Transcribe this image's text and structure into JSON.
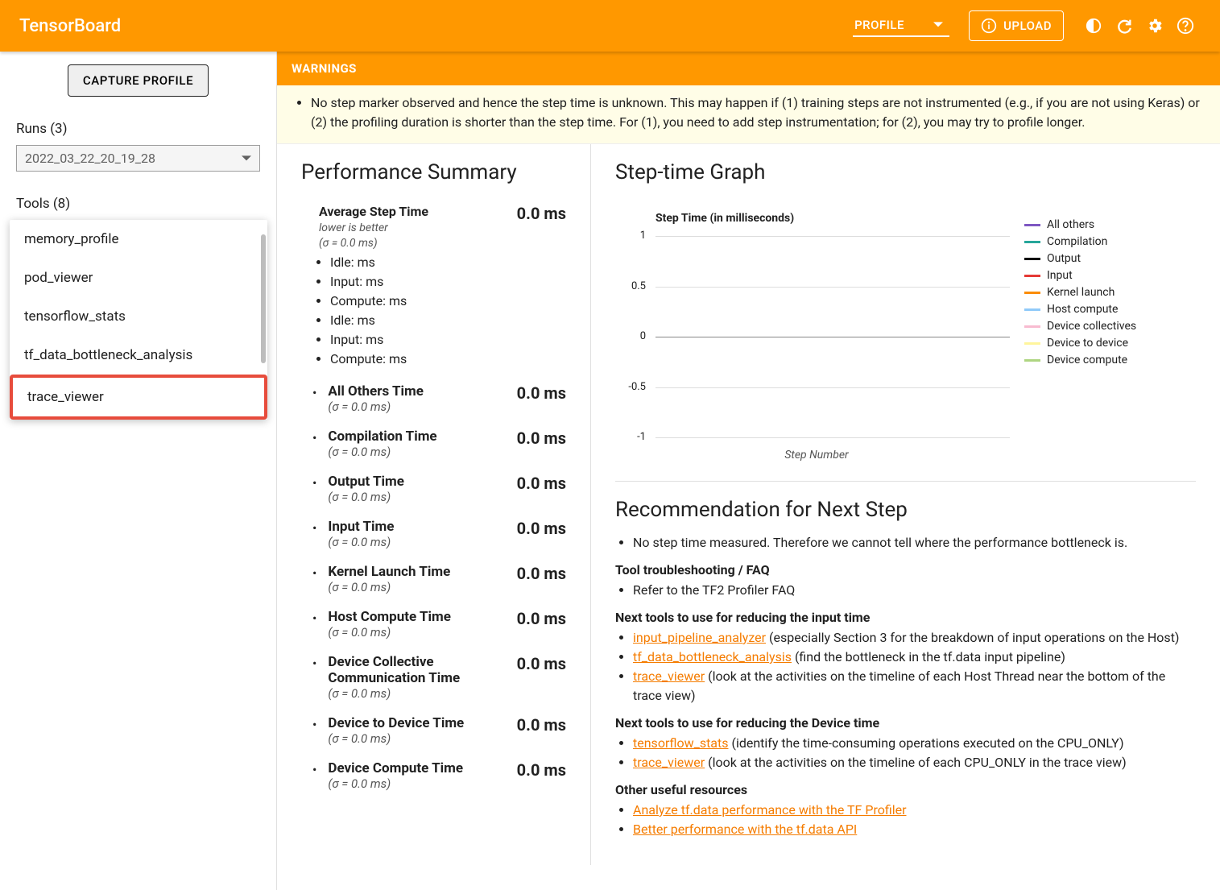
{
  "header": {
    "title": "TensorBoard",
    "mode": "PROFILE",
    "upload": "UPLOAD"
  },
  "sidebar": {
    "capture": "CAPTURE PROFILE",
    "runs_label": "Runs (3)",
    "run_selected": "2022_03_22_20_19_28",
    "tools_label": "Tools (8)",
    "tools": [
      "memory_profile",
      "pod_viewer",
      "tensorflow_stats",
      "tf_data_bottleneck_analysis",
      "trace_viewer"
    ]
  },
  "warnings": {
    "title": "WARNINGS",
    "items": [
      "No step marker observed and hence the step time is unknown. This may happen if (1) training steps are not instrumented (e.g., if you are not using Keras) or (2) the profiling duration is shorter than the step time. For (1), you need to add step instrumentation; for (2), you may try to profile longer."
    ]
  },
  "perf": {
    "title": "Performance Summary",
    "avg": {
      "label": "Average Step Time",
      "hint": "lower is better",
      "sigma": "(σ = 0.0 ms)",
      "val": "0.0 ms",
      "subs": [
        "Idle: ms",
        "Input: ms",
        "Compute: ms",
        "Idle: ms",
        "Input: ms",
        "Compute: ms"
      ]
    },
    "items": [
      {
        "label": "All Others Time",
        "sigma": "(σ = 0.0 ms)",
        "val": "0.0 ms"
      },
      {
        "label": "Compilation Time",
        "sigma": "(σ = 0.0 ms)",
        "val": "0.0 ms"
      },
      {
        "label": "Output Time",
        "sigma": "(σ = 0.0 ms)",
        "val": "0.0 ms"
      },
      {
        "label": "Input Time",
        "sigma": "(σ = 0.0 ms)",
        "val": "0.0 ms"
      },
      {
        "label": "Kernel Launch Time",
        "sigma": "(σ = 0.0 ms)",
        "val": "0.0 ms"
      },
      {
        "label": "Host Compute Time",
        "sigma": "(σ = 0.0 ms)",
        "val": "0.0 ms"
      },
      {
        "label": "Device Collective Communication Time",
        "sigma": "(σ = 0.0 ms)",
        "val": "0.0 ms"
      },
      {
        "label": "Device to Device Time",
        "sigma": "(σ = 0.0 ms)",
        "val": "0.0 ms"
      },
      {
        "label": "Device Compute Time",
        "sigma": "(σ = 0.0 ms)",
        "val": "0.0 ms"
      }
    ]
  },
  "chart_data": {
    "type": "line",
    "title": "Step Time (in milliseconds)",
    "xlabel": "Step Number",
    "ylabel": "",
    "ylim": [
      -1,
      1
    ],
    "yticks": [
      -1,
      -0.5,
      0,
      0.5,
      1
    ],
    "categories": [],
    "series": [
      {
        "name": "All others",
        "color": "#7e57c2",
        "values": []
      },
      {
        "name": "Compilation",
        "color": "#26a69a",
        "values": []
      },
      {
        "name": "Output",
        "color": "#000000",
        "values": []
      },
      {
        "name": "Input",
        "color": "#e53935",
        "values": []
      },
      {
        "name": "Kernel launch",
        "color": "#fb8c00",
        "values": []
      },
      {
        "name": "Host compute",
        "color": "#90caf9",
        "values": []
      },
      {
        "name": "Device collectives",
        "color": "#f8bbd0",
        "values": []
      },
      {
        "name": "Device to device",
        "color": "#fff59d",
        "values": []
      },
      {
        "name": "Device compute",
        "color": "#aed581",
        "values": []
      }
    ]
  },
  "graph": {
    "title": "Step-time Graph"
  },
  "reco": {
    "title": "Recommendation for Next Step",
    "b1": "No step time measured. Therefore we cannot tell where the performance bottleneck is.",
    "h1": "Tool troubleshooting / FAQ",
    "l1": "Refer to the TF2 Profiler FAQ",
    "h2": "Next tools to use for reducing the input time",
    "a1": "input_pipeline_analyzer",
    "t1": " (especially Section 3 for the breakdown of input operations on the Host)",
    "a2": "tf_data_bottleneck_analysis",
    "t2": " (find the bottleneck in the tf.data input pipeline)",
    "a3": "trace_viewer",
    "t3": " (look at the activities on the timeline of each Host Thread near the bottom of the trace view)",
    "h3": "Next tools to use for reducing the Device time",
    "a4": "tensorflow_stats",
    "t4": " (identify the time-consuming operations executed on the CPU_ONLY)",
    "a5": "trace_viewer",
    "t5": " (look at the activities on the timeline of each CPU_ONLY in the trace view)",
    "h4": "Other useful resources",
    "a6": "Analyze tf.data performance with the TF Profiler",
    "a7": "Better performance with the tf.data API"
  }
}
